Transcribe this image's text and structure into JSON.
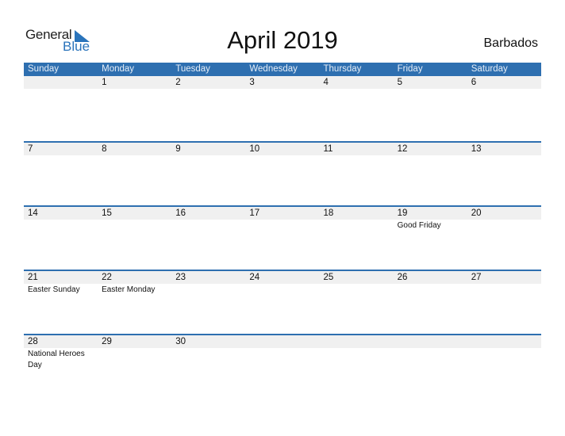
{
  "logo": {
    "line1": "General",
    "line2": "Blue",
    "accent": "#2a74bb"
  },
  "title": "April 2019",
  "country": "Barbados",
  "header_color": "#2e6fb0",
  "weekdays": [
    "Sunday",
    "Monday",
    "Tuesday",
    "Wednesday",
    "Thursday",
    "Friday",
    "Saturday"
  ],
  "weeks": [
    {
      "days": [
        "",
        "1",
        "2",
        "3",
        "4",
        "5",
        "6"
      ],
      "events": [
        "",
        "",
        "",
        "",
        "",
        "",
        ""
      ]
    },
    {
      "days": [
        "7",
        "8",
        "9",
        "10",
        "11",
        "12",
        "13"
      ],
      "events": [
        "",
        "",
        "",
        "",
        "",
        "",
        ""
      ]
    },
    {
      "days": [
        "14",
        "15",
        "16",
        "17",
        "18",
        "19",
        "20"
      ],
      "events": [
        "",
        "",
        "",
        "",
        "",
        "Good Friday",
        ""
      ]
    },
    {
      "days": [
        "21",
        "22",
        "23",
        "24",
        "25",
        "26",
        "27"
      ],
      "events": [
        "Easter Sunday",
        "Easter Monday",
        "",
        "",
        "",
        "",
        ""
      ]
    },
    {
      "days": [
        "28",
        "29",
        "30",
        "",
        "",
        "",
        ""
      ],
      "events": [
        "National Heroes Day",
        "",
        "",
        "",
        "",
        "",
        ""
      ]
    }
  ]
}
